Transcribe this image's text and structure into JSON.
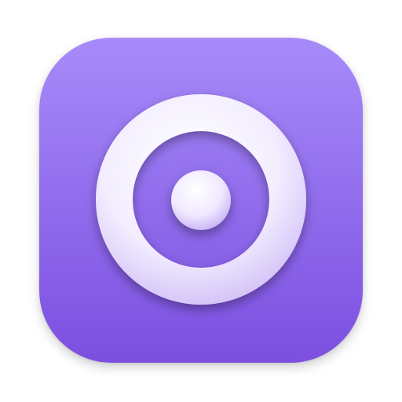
{
  "app_icon": {
    "icon_name": "target-rings-icon",
    "colors": {
      "background_top": "#a78bfa",
      "background_bottom": "#7c4fe0",
      "ring_highlight": "#ffffff",
      "ring_shade": "#c9b5f5",
      "dot_highlight": "#ffffff",
      "dot_shade": "#b9a1f0"
    }
  }
}
